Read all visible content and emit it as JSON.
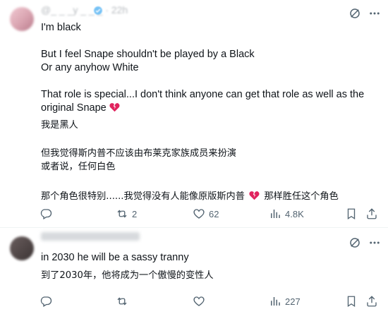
{
  "theme": {
    "text": "#0f1419",
    "muted": "#536471",
    "divider": "#eff3f4",
    "heart_broken": "#e0245e"
  },
  "posts": [
    {
      "handle": "@_ _ _y _ _ _ · 22h",
      "lines_en": [
        "I'm black",
        "",
        "But I feel Snape shouldn't be played by a Black",
        "Or any anyhow White",
        "",
        "That role is special...I don't think anyone can get that role as well as the",
        "original Snape"
      ],
      "lines_zh": [
        "我是黑人",
        "",
        "但我觉得斯内普不应该由布莱克家族成员来扮演",
        "或者说，任何白色",
        "",
        "那个角色很特别......我觉得没有人能像原版斯内普",
        "那样胜任这个角色"
      ],
      "emoji": "broken-heart-emoji",
      "stats": {
        "replies": "",
        "reposts": "2",
        "likes": "62",
        "views": "4.8K"
      }
    },
    {
      "handle": "",
      "line_en": "in 2030 he will be a sassy tranny",
      "line_zh": "到了2030年，他将成为一个傲慢的变性人",
      "stats": {
        "replies": "",
        "reposts": "",
        "likes": "",
        "views": "227"
      }
    }
  ],
  "icons": [
    "grok-icon",
    "more-icon",
    "reply-icon",
    "repost-icon",
    "like-icon",
    "views-icon",
    "bookmark-icon",
    "share-icon",
    "verified-badge-icon"
  ]
}
